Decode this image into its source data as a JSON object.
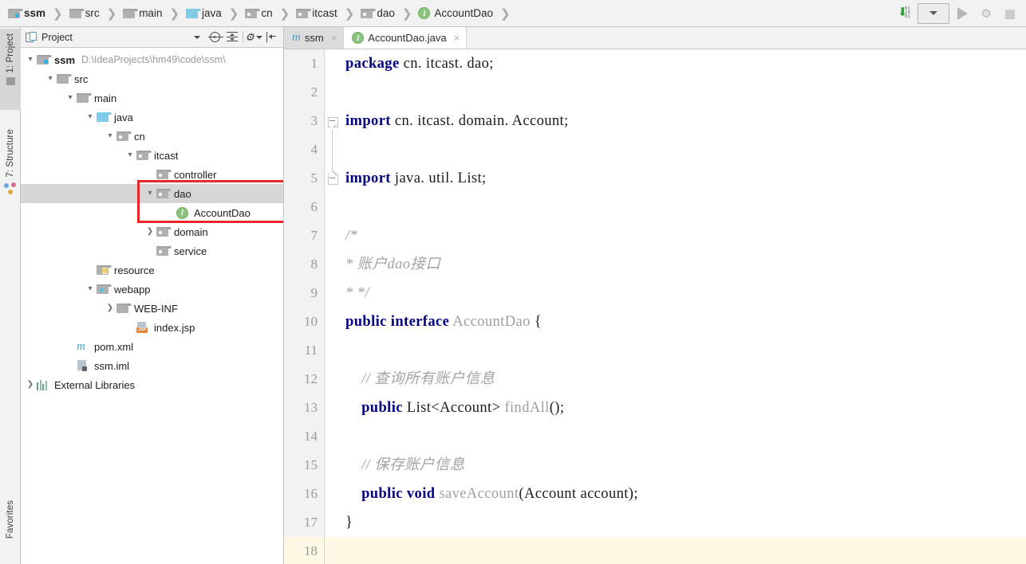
{
  "breadcrumb": {
    "items": [
      {
        "label": "ssm",
        "icon": "module-folder-icon",
        "bold": true
      },
      {
        "label": "src",
        "icon": "folder-icon",
        "bold": false
      },
      {
        "label": "main",
        "icon": "folder-icon",
        "bold": false
      },
      {
        "label": "java",
        "icon": "source-folder-icon",
        "bold": false
      },
      {
        "label": "cn",
        "icon": "package-folder-icon",
        "bold": false
      },
      {
        "label": "itcast",
        "icon": "package-folder-icon",
        "bold": false
      },
      {
        "label": "dao",
        "icon": "package-folder-icon",
        "bold": false
      },
      {
        "label": "AccountDao",
        "icon": "interface-icon",
        "bold": false
      }
    ],
    "separator": "❯"
  },
  "toolbar": {
    "update_icon": "update-project-icon",
    "update_bits": "01\n10\n01",
    "config_selector": "run-configuration-selector",
    "run_label": "run-button",
    "debug_label": "debug-button",
    "coverage_label": "coverage-button"
  },
  "rail": {
    "project": "1: Project",
    "structure": "7: Structure",
    "favorites": "Favorites"
  },
  "project_panel": {
    "title": "Project",
    "buttons": [
      "chevron-down-icon",
      "locate-icon",
      "collapse-all-icon",
      "settings-gear-icon",
      "hide-panel-icon"
    ],
    "tree": [
      {
        "depth": 0,
        "arrow": "⌄",
        "icon": "module-folder-icon",
        "label": "ssm",
        "bold": true,
        "path": "D:\\IdeaProjects\\hm49\\code\\ssm\\",
        "selected": false
      },
      {
        "depth": 1,
        "arrow": "⌄",
        "icon": "folder-icon",
        "label": "src",
        "bold": false,
        "path": "",
        "selected": false
      },
      {
        "depth": 2,
        "arrow": "⌄",
        "icon": "folder-icon",
        "label": "main",
        "bold": false,
        "path": "",
        "selected": false
      },
      {
        "depth": 3,
        "arrow": "⌄",
        "icon": "source-folder-icon",
        "label": "java",
        "bold": false,
        "path": "",
        "selected": false
      },
      {
        "depth": 4,
        "arrow": "⌄",
        "icon": "package-folder-icon",
        "label": "cn",
        "bold": false,
        "path": "",
        "selected": false
      },
      {
        "depth": 5,
        "arrow": "⌄",
        "icon": "package-folder-icon",
        "label": "itcast",
        "bold": false,
        "path": "",
        "selected": false
      },
      {
        "depth": 6,
        "arrow": "",
        "icon": "package-folder-icon",
        "label": "controller",
        "bold": false,
        "path": "",
        "selected": false
      },
      {
        "depth": 6,
        "arrow": "⌄",
        "icon": "package-folder-icon",
        "label": "dao",
        "bold": false,
        "path": "",
        "selected": true
      },
      {
        "depth": 7,
        "arrow": "",
        "icon": "interface-icon",
        "label": "AccountDao",
        "bold": false,
        "path": "",
        "selected": false
      },
      {
        "depth": 6,
        "arrow": "›",
        "icon": "package-folder-icon",
        "label": "domain",
        "bold": false,
        "path": "",
        "selected": false
      },
      {
        "depth": 6,
        "arrow": "",
        "icon": "package-folder-icon",
        "label": "service",
        "bold": false,
        "path": "",
        "selected": false
      },
      {
        "depth": 3,
        "arrow": "",
        "icon": "resource-folder-icon",
        "label": "resource",
        "bold": false,
        "path": "",
        "selected": false
      },
      {
        "depth": 3,
        "arrow": "⌄",
        "icon": "webapp-folder-icon",
        "label": "webapp",
        "bold": false,
        "path": "",
        "selected": false
      },
      {
        "depth": 4,
        "arrow": "›",
        "icon": "folder-icon",
        "label": "WEB-INF",
        "bold": false,
        "path": "",
        "selected": false
      },
      {
        "depth": 5,
        "arrow": "",
        "icon": "jsp-file-icon",
        "label": "index.jsp",
        "bold": false,
        "path": "",
        "selected": false
      },
      {
        "depth": 2,
        "arrow": "",
        "icon": "maven-file-icon",
        "label": "pom.xml",
        "bold": false,
        "path": "",
        "selected": false
      },
      {
        "depth": 2,
        "arrow": "",
        "icon": "iml-file-icon",
        "label": "ssm.iml",
        "bold": false,
        "path": "",
        "selected": false
      },
      {
        "depth": 0,
        "arrow": "›",
        "icon": "external-libraries-icon",
        "label": "External Libraries",
        "bold": false,
        "path": "",
        "selected": false
      }
    ],
    "highlight_color": "#e8272b"
  },
  "editor": {
    "tabs": [
      {
        "label": "ssm",
        "icon": "maven-file-icon",
        "active": false,
        "close": "×"
      },
      {
        "label": "AccountDao.java",
        "icon": "interface-icon",
        "active": true,
        "close": "×"
      }
    ],
    "line_numbers": [
      "1",
      "2",
      "3",
      "4",
      "5",
      "6",
      "7",
      "8",
      "9",
      "10",
      "11",
      "12",
      "13",
      "14",
      "15",
      "16",
      "17",
      "18"
    ],
    "caret_line": 18,
    "caret_line_color": "#fcf8e4",
    "lines": [
      {
        "n": 1,
        "tokens": [
          {
            "t": "package",
            "c": "kw"
          },
          {
            "t": " cn. itcast. dao;",
            "c": ""
          }
        ]
      },
      {
        "n": 2,
        "tokens": []
      },
      {
        "n": 3,
        "tokens": [
          {
            "t": "import",
            "c": "kw"
          },
          {
            "t": " cn. itcast. domain. Account;",
            "c": ""
          }
        ]
      },
      {
        "n": 4,
        "tokens": []
      },
      {
        "n": 5,
        "tokens": [
          {
            "t": "import",
            "c": "kw"
          },
          {
            "t": " java. util. List;",
            "c": ""
          }
        ]
      },
      {
        "n": 6,
        "tokens": []
      },
      {
        "n": 7,
        "tokens": [
          {
            "t": "/*",
            "c": "cm"
          }
        ]
      },
      {
        "n": 8,
        "tokens": [
          {
            "t": "* 账户dao接口",
            "c": "cm"
          }
        ]
      },
      {
        "n": 9,
        "tokens": [
          {
            "t": "* */",
            "c": "cm"
          }
        ]
      },
      {
        "n": 10,
        "tokens": [
          {
            "t": "public interface",
            "c": "kw"
          },
          {
            "t": " ",
            "c": ""
          },
          {
            "t": "AccountDao",
            "c": "id"
          },
          {
            "t": " {",
            "c": ""
          }
        ]
      },
      {
        "n": 11,
        "tokens": []
      },
      {
        "n": 12,
        "tokens": [
          {
            "t": "    // 查询所有账户信息",
            "c": "cm"
          }
        ]
      },
      {
        "n": 13,
        "tokens": [
          {
            "t": "    ",
            "c": ""
          },
          {
            "t": "public",
            "c": "kw"
          },
          {
            "t": " List<Account> ",
            "c": ""
          },
          {
            "t": "findAll",
            "c": "id"
          },
          {
            "t": "();",
            "c": ""
          }
        ]
      },
      {
        "n": 14,
        "tokens": []
      },
      {
        "n": 15,
        "tokens": [
          {
            "t": "    // 保存账户信息",
            "c": "cm"
          }
        ]
      },
      {
        "n": 16,
        "tokens": [
          {
            "t": "    ",
            "c": ""
          },
          {
            "t": "public void",
            "c": "kw"
          },
          {
            "t": " ",
            "c": ""
          },
          {
            "t": "saveAccount",
            "c": "id"
          },
          {
            "t": "(Account account);",
            "c": ""
          }
        ]
      },
      {
        "n": 17,
        "tokens": [
          {
            "t": "}",
            "c": ""
          }
        ]
      },
      {
        "n": 18,
        "tokens": []
      }
    ],
    "fold_markers": [
      {
        "line": 3,
        "dir": "down"
      },
      {
        "line": 5,
        "dir": "up"
      }
    ]
  },
  "colors": {
    "keyword": "#000080",
    "comment": "#a3a3a3",
    "identifier": "#9e9e9e",
    "selection": "#d6d6d6",
    "accent_red": "#e8272b",
    "chrome": "#f2f2f2"
  }
}
